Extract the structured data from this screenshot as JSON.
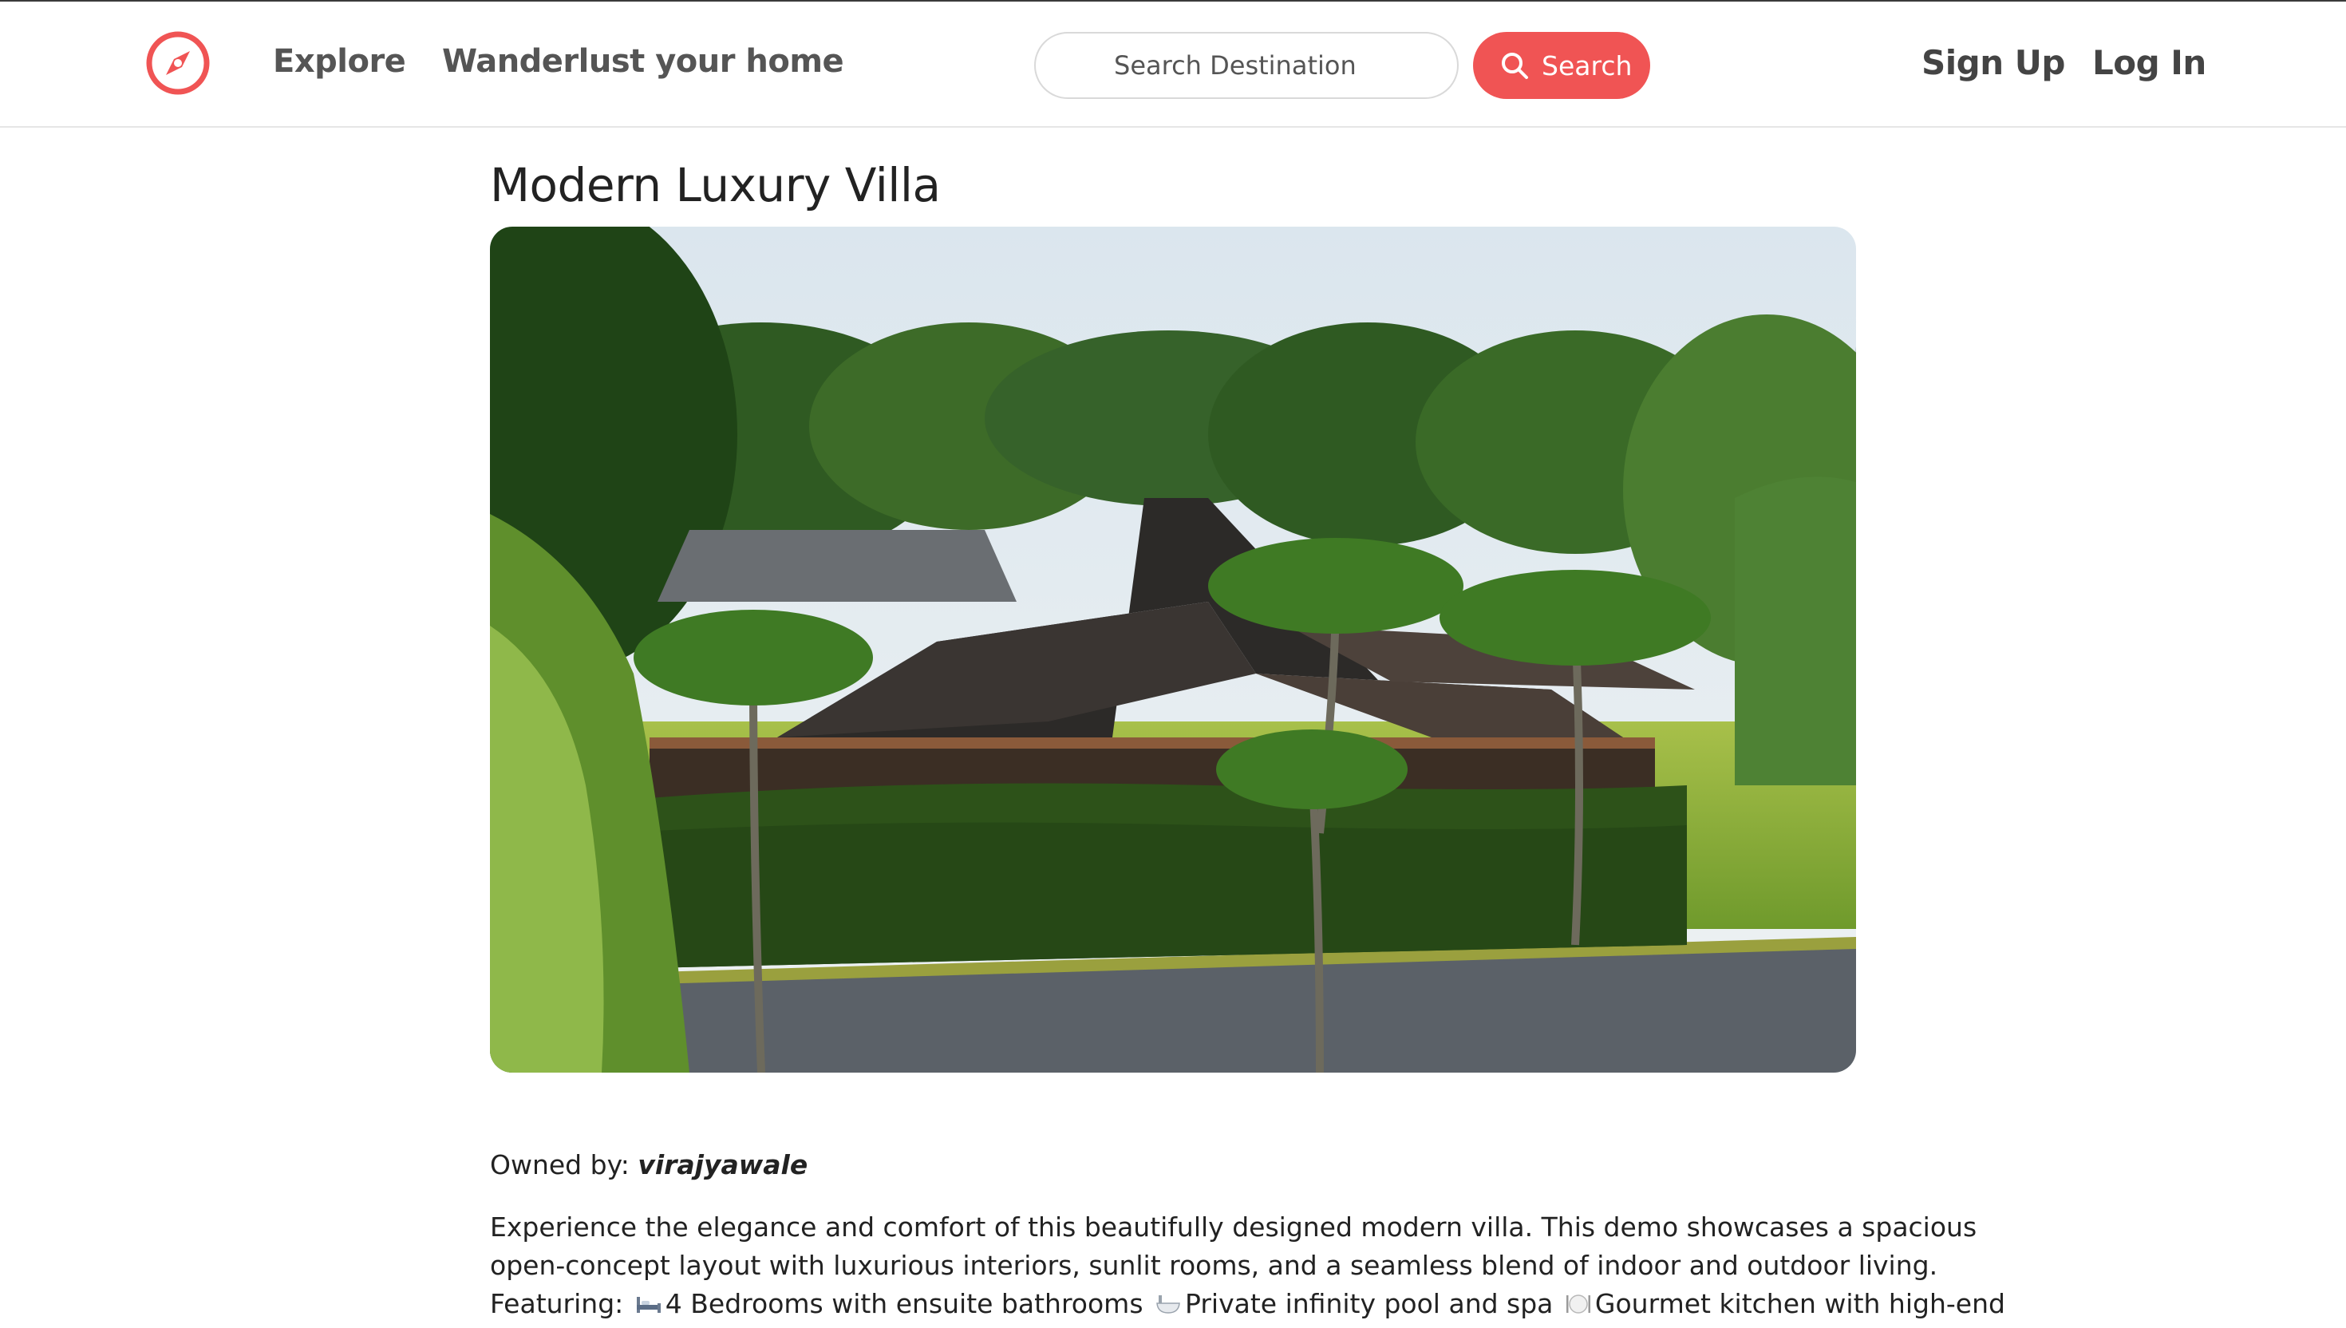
{
  "nav": {
    "logo_icon": "compass-icon",
    "links": [
      {
        "label": "Explore"
      },
      {
        "label": "Wanderlust your home"
      }
    ],
    "search": {
      "placeholder": "Search Destination",
      "button_label": "Search",
      "button_icon": "search-icon"
    },
    "auth": {
      "signup_label": "Sign Up",
      "login_label": "Log In"
    }
  },
  "listing": {
    "title": "Modern Luxury Villa",
    "owner_prefix": "Owned by: ",
    "owner_name": "virajyawale",
    "description_lines": [
      "Experience the elegance and comfort of this beautifully designed modern villa. This demo showcases a spacious",
      "open-concept layout with luxurious interiors, sunlit rooms, and a seamless blend of indoor and outdoor living."
    ],
    "features": {
      "prefix": "Featuring:",
      "items": [
        {
          "icon": "bed-icon",
          "text": "4 Bedrooms with ensuite bathrooms"
        },
        {
          "icon": "bathtub-icon",
          "text": "Private infinity pool and spa"
        },
        {
          "icon": "plate-icon",
          "text": "Gourmet kitchen with high-end"
        }
      ]
    }
  },
  "colors": {
    "accent": "#f05454",
    "text": "#222222",
    "nav_text": "#555555"
  }
}
